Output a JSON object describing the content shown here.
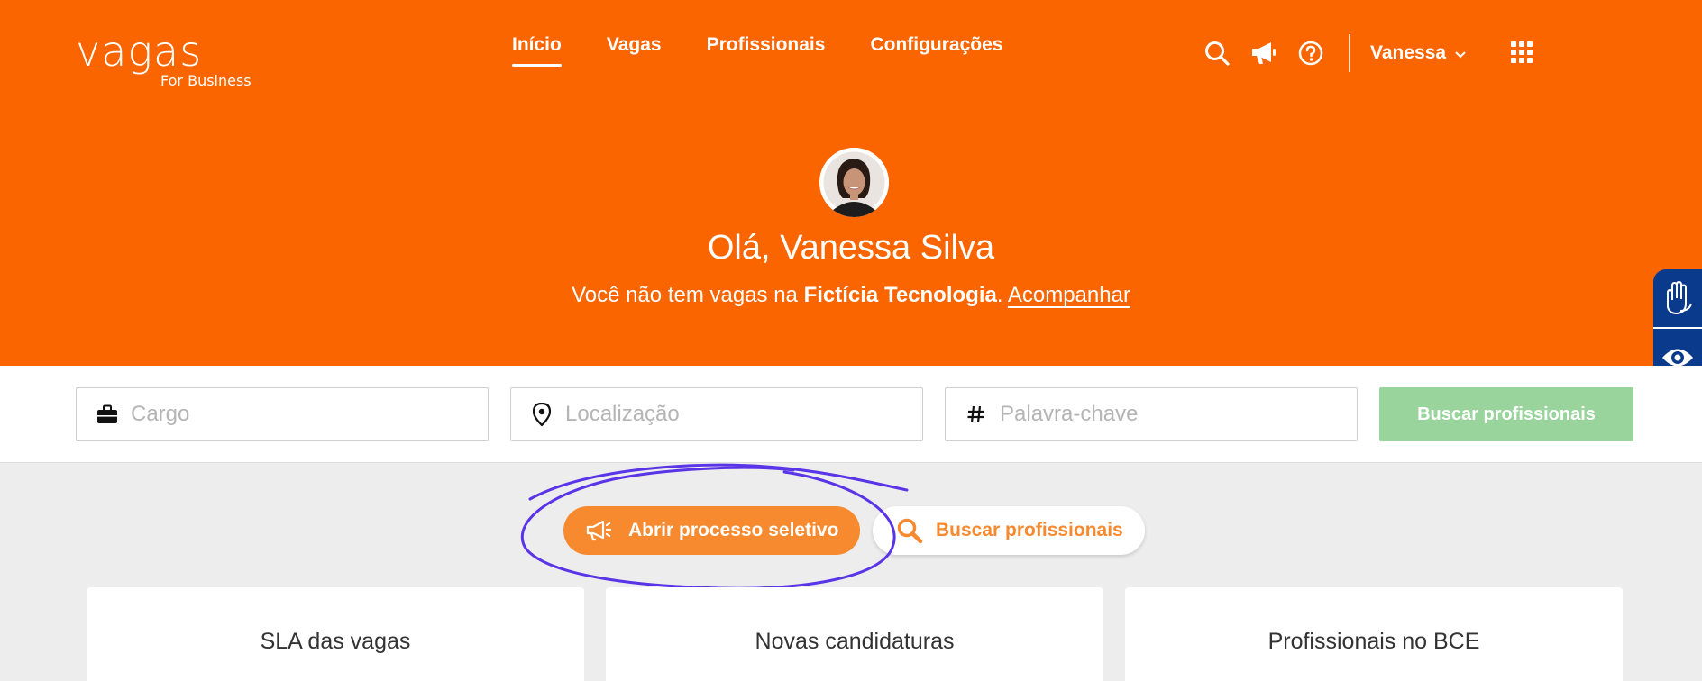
{
  "brand": {
    "name": "vagas",
    "tagline": "For Business"
  },
  "nav": {
    "items": [
      {
        "label": "Início",
        "active": true
      },
      {
        "label": "Vagas",
        "active": false
      },
      {
        "label": "Profissionais",
        "active": false
      },
      {
        "label": "Configurações",
        "active": false
      }
    ]
  },
  "header_icons": [
    "search-icon",
    "megaphone-icon",
    "help-icon"
  ],
  "user": {
    "name": "Vanessa"
  },
  "hero": {
    "greeting": "Olá, Vanessa Silva",
    "message_prefix": "Você não tem vagas na ",
    "company": "Fictícia Tecnologia",
    "message_suffix": ". ",
    "link": "Acompanhar"
  },
  "search": {
    "cargo_placeholder": "Cargo",
    "localizacao_placeholder": "Localização",
    "palavra_placeholder": "Palavra-chave",
    "button_label": "Buscar profissionais"
  },
  "actions": {
    "primary_label": "Abrir processo seletivo",
    "secondary_label": "Buscar profissionais"
  },
  "cards": [
    {
      "title": "SLA das vagas"
    },
    {
      "title": "Novas candidaturas"
    },
    {
      "title": "Profissionais no BCE"
    }
  ],
  "colors": {
    "brand_orange": "#fb6500",
    "button_orange": "#f7892f",
    "search_button_green": "#98d49c",
    "accessibility_blue": "#0a3a8c",
    "annotation_purple": "#5a35e8"
  }
}
